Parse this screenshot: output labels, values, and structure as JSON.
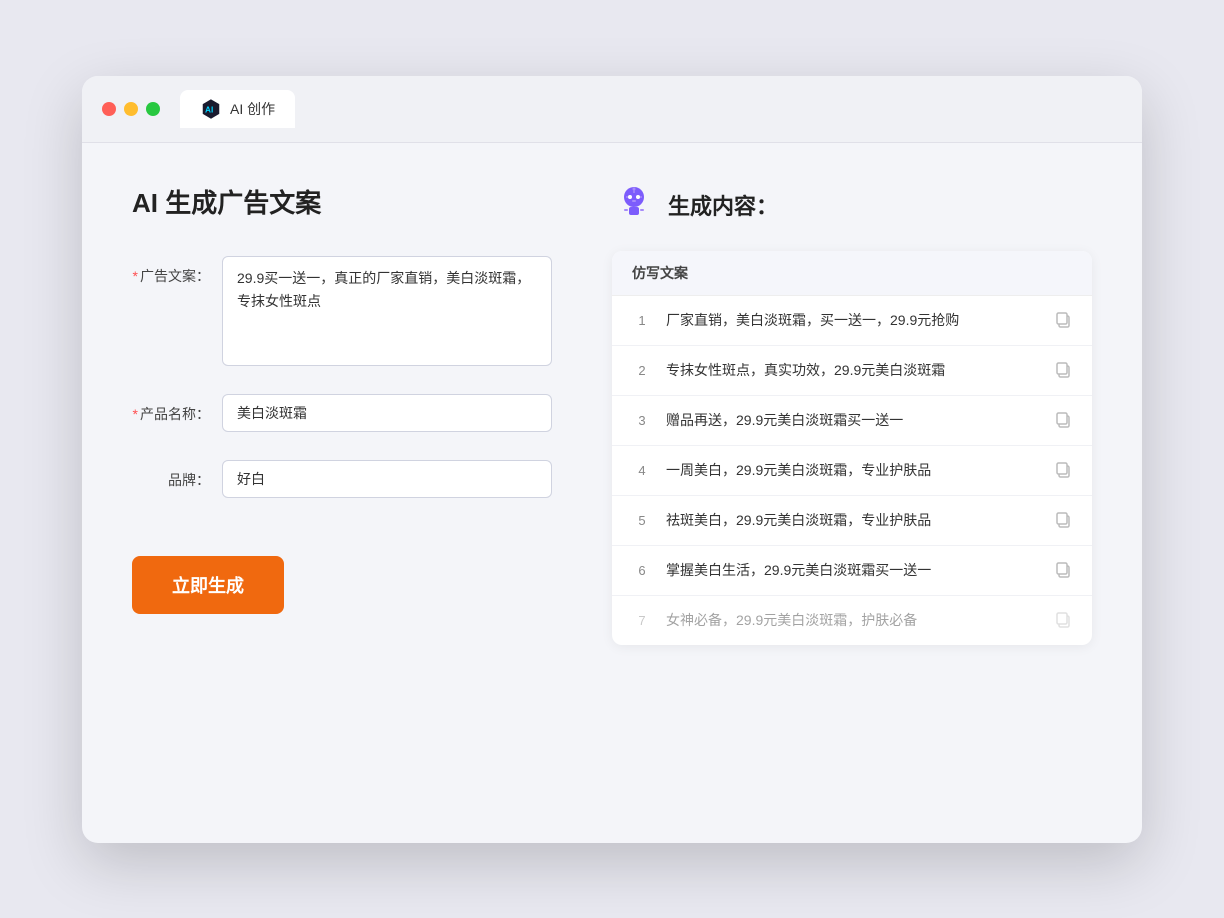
{
  "window": {
    "tab_label": "AI 创作"
  },
  "left_panel": {
    "title": "AI 生成广告文案",
    "form": {
      "ad_copy_label": "广告文案：",
      "ad_copy_required": true,
      "ad_copy_value": "29.9买一送一，真正的厂家直销，美白淡斑霜，专抹女性斑点",
      "product_name_label": "产品名称：",
      "product_name_required": true,
      "product_name_value": "美白淡斑霜",
      "brand_label": "品牌：",
      "brand_required": false,
      "brand_value": "好白"
    },
    "button_label": "立即生成"
  },
  "right_panel": {
    "title": "生成内容：",
    "table_header": "仿写文案",
    "results": [
      {
        "num": "1",
        "text": "厂家直销，美白淡斑霜，买一送一，29.9元抢购",
        "faded": false
      },
      {
        "num": "2",
        "text": "专抹女性斑点，真实功效，29.9元美白淡斑霜",
        "faded": false
      },
      {
        "num": "3",
        "text": "赠品再送，29.9元美白淡斑霜买一送一",
        "faded": false
      },
      {
        "num": "4",
        "text": "一周美白，29.9元美白淡斑霜，专业护肤品",
        "faded": false
      },
      {
        "num": "5",
        "text": "祛斑美白，29.9元美白淡斑霜，专业护肤品",
        "faded": false
      },
      {
        "num": "6",
        "text": "掌握美白生活，29.9元美白淡斑霜买一送一",
        "faded": false
      },
      {
        "num": "7",
        "text": "女神必备，29.9元美白淡斑霜，护肤必备",
        "faded": true
      }
    ]
  }
}
